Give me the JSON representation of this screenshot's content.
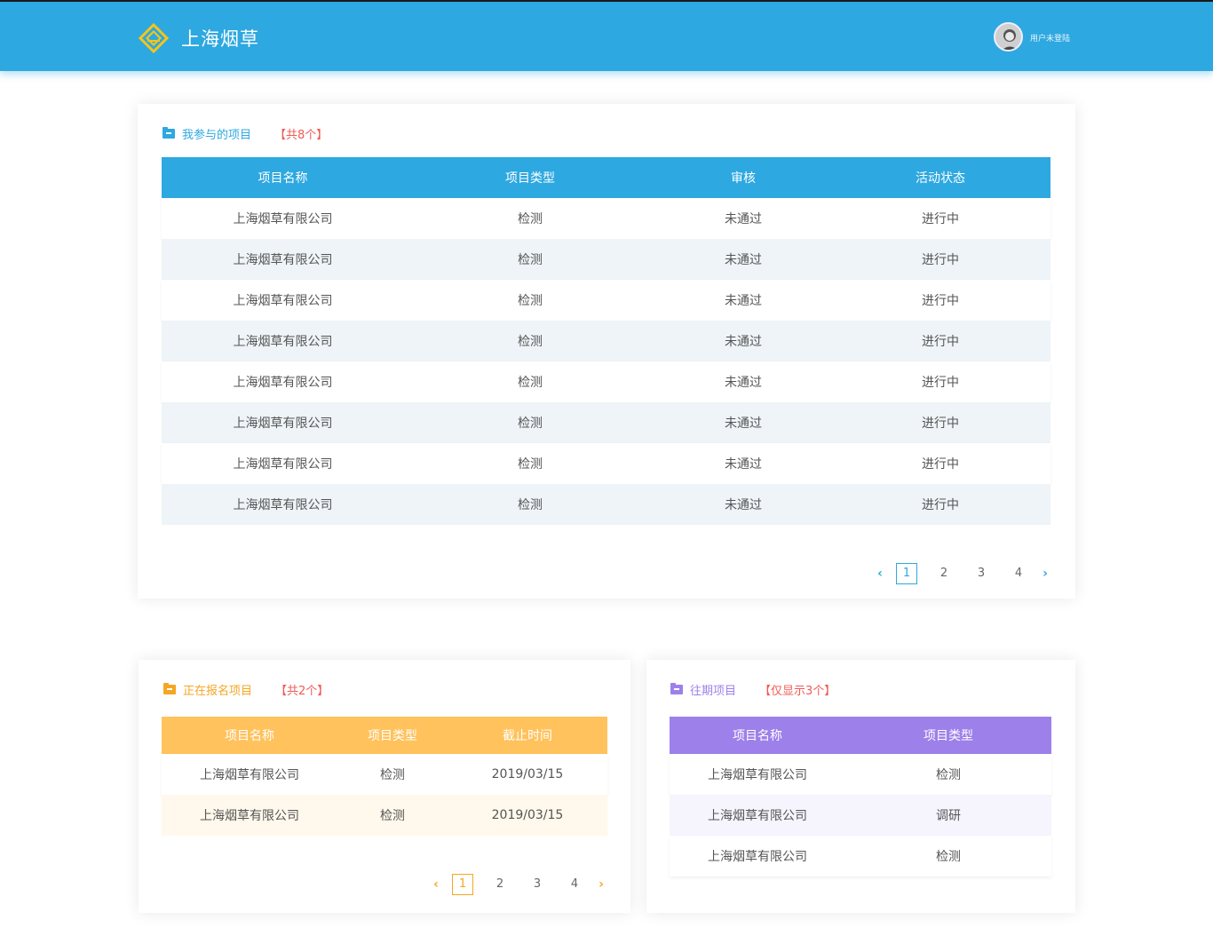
{
  "header": {
    "app_title": "上海烟草",
    "user_status": "用户未登陆"
  },
  "colors": {
    "primary": "#2ea8e0",
    "orange": "#ffc25c",
    "purple": "#9d80ea",
    "count_red": "#f05a55"
  },
  "icons": {
    "logo": "diamond-logo-icon",
    "section": "folder-icon",
    "prev": "chevron-left-icon",
    "next": "chevron-right-icon"
  },
  "my_projects": {
    "title": "我参与的项目",
    "count": "【共8个】",
    "columns": [
      "项目名称",
      "项目类型",
      "审核",
      "活动状态"
    ],
    "rows": [
      [
        "上海烟草有限公司",
        "检测",
        "未通过",
        "进行中"
      ],
      [
        "上海烟草有限公司",
        "检测",
        "未通过",
        "进行中"
      ],
      [
        "上海烟草有限公司",
        "检测",
        "未通过",
        "进行中"
      ],
      [
        "上海烟草有限公司",
        "检测",
        "未通过",
        "进行中"
      ],
      [
        "上海烟草有限公司",
        "检测",
        "未通过",
        "进行中"
      ],
      [
        "上海烟草有限公司",
        "检测",
        "未通过",
        "进行中"
      ],
      [
        "上海烟草有限公司",
        "检测",
        "未通过",
        "进行中"
      ],
      [
        "上海烟草有限公司",
        "检测",
        "未通过",
        "进行中"
      ]
    ],
    "pagination": {
      "prev": "‹",
      "pages": [
        "1",
        "2",
        "3",
        "4"
      ],
      "active": "1",
      "next": "›"
    }
  },
  "registering": {
    "title": "正在报名项目",
    "count": "【共2个】",
    "columns": [
      "项目名称",
      "项目类型",
      "截止时间"
    ],
    "rows": [
      [
        "上海烟草有限公司",
        "检测",
        "2019/03/15"
      ],
      [
        "上海烟草有限公司",
        "检测",
        "2019/03/15"
      ]
    ],
    "pagination": {
      "prev": "‹",
      "pages": [
        "1",
        "2",
        "3",
        "4"
      ],
      "active": "1",
      "next": "›"
    }
  },
  "past": {
    "title": "往期项目",
    "count": "【仅显示3个】",
    "columns": [
      "项目名称",
      "项目类型"
    ],
    "rows": [
      [
        "上海烟草有限公司",
        "检测"
      ],
      [
        "上海烟草有限公司",
        "调研"
      ],
      [
        "上海烟草有限公司",
        "检测"
      ]
    ]
  }
}
